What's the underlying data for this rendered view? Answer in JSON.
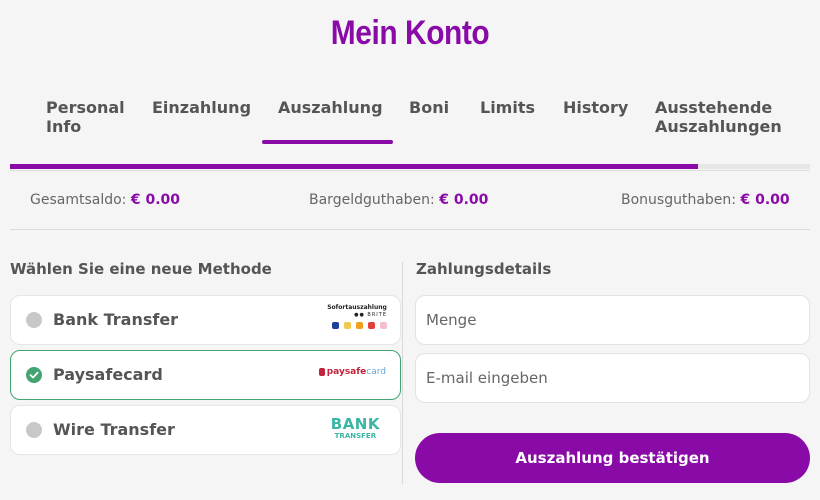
{
  "page": {
    "title": "Mein Konto"
  },
  "tabs": [
    {
      "label": "Personal Info"
    },
    {
      "label": "Einzahlung"
    },
    {
      "label": "Auszahlung",
      "active": true
    },
    {
      "label": "Boni"
    },
    {
      "label": "Limits"
    },
    {
      "label": "History"
    },
    {
      "label": "Ausstehende Auszahlungen"
    }
  ],
  "progress": {
    "fraction": 0.86
  },
  "balances": {
    "total_label": "Gesamtsaldo:",
    "total_value": "€ 0.00",
    "cash_label": "Bargeldguthaben:",
    "cash_value": "€ 0.00",
    "bonus_label": "Bonusguthaben:",
    "bonus_value": "€ 0.00"
  },
  "methods": {
    "title": "Wählen Sie eine neue Methode",
    "items": [
      {
        "label": "Bank Transfer",
        "selected": false,
        "logo_text_1": "Sofortauszahlung",
        "logo_text_2": "●● BRITE",
        "logo_icon": "sofort-brite-logo"
      },
      {
        "label": "Paysafecard",
        "selected": true,
        "logo_text_1": "paysafe",
        "logo_text_2": "card",
        "logo_icon": "paysafecard-logo"
      },
      {
        "label": "Wire Transfer",
        "selected": false,
        "logo_text_1": "BANK",
        "logo_text_2": "TRANSFER",
        "logo_icon": "bank-transfer-logo"
      }
    ]
  },
  "details": {
    "title": "Zahlungsdetails",
    "amount_placeholder": "Menge",
    "email_placeholder": "E-mail eingeben",
    "confirm_label": "Auszahlung bestätigen"
  },
  "colors": {
    "brand": "#8a0aa8",
    "success": "#43a371",
    "radio_off": "#c8c8c8"
  }
}
